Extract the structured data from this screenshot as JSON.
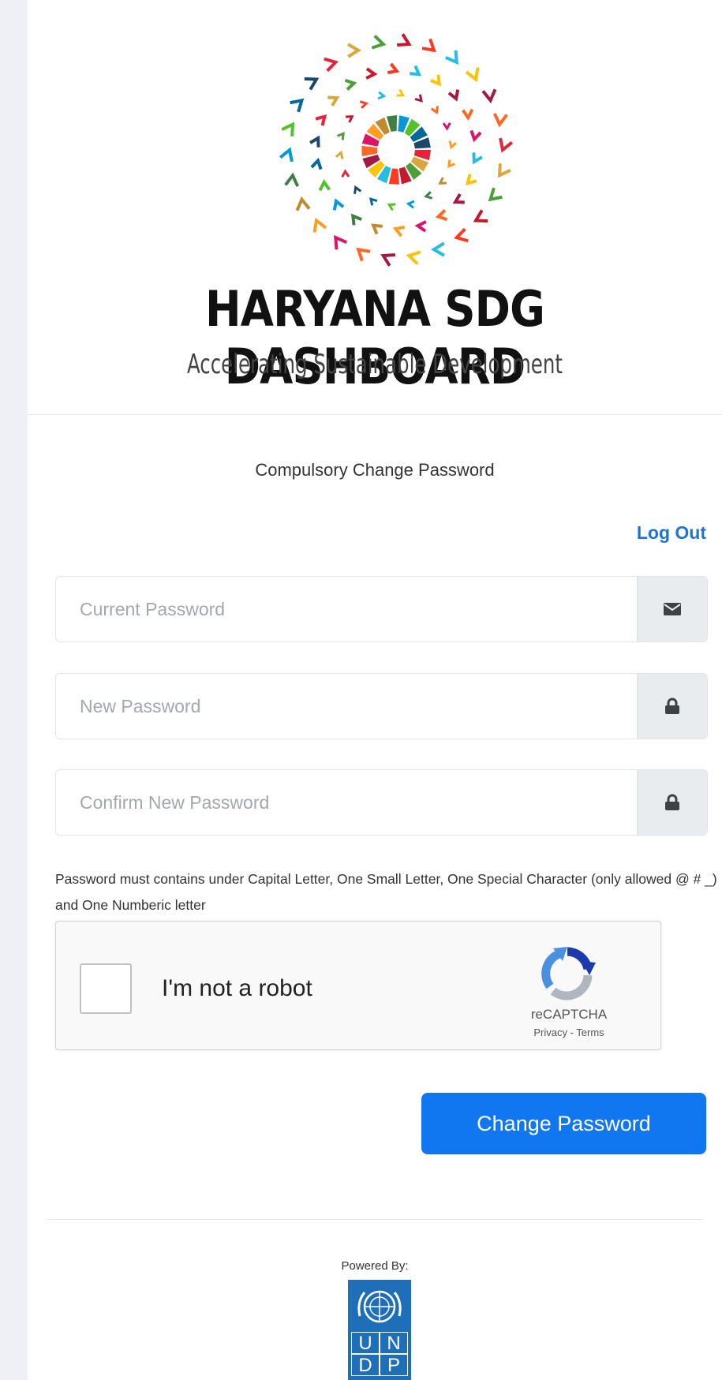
{
  "brand": {
    "title": "HARYANA SDG DASHBOARD",
    "subtitle": "Accelerating Sustainable Development"
  },
  "form": {
    "heading": "Compulsory Change Password",
    "logout_label": "Log Out",
    "current_password": {
      "placeholder": "Current Password",
      "icon": "envelope-icon"
    },
    "new_password": {
      "placeholder": "New Password",
      "icon": "lock-icon"
    },
    "confirm_password": {
      "placeholder": "Confirm New Password",
      "icon": "lock-icon"
    },
    "hint": "Password must contains under Capital Letter, One Small Letter, One Special Character (only allowed @ # _) and One Numberic letter",
    "submit_label": "Change Password"
  },
  "captcha": {
    "label": "I'm not a robot",
    "brand": "reCAPTCHA",
    "links": "Privacy - Terms"
  },
  "footer": {
    "powered_by": "Powered By:",
    "logo_letters": [
      "U",
      "N",
      "D",
      "P"
    ]
  },
  "colors": {
    "accent": "#1077f0",
    "link": "#1e73d8",
    "undp_blue": "#1f6fb8"
  }
}
